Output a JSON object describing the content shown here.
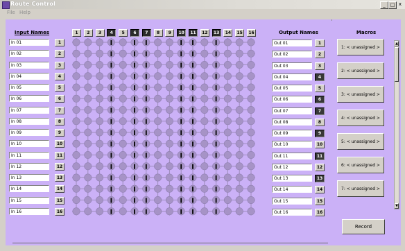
{
  "window": {
    "title": "Route Control",
    "minimize": "_",
    "restore": "□",
    "close": "x"
  },
  "menu": [
    "File",
    "Help"
  ],
  "headers": {
    "inputs": "Input Names",
    "outputs": "Output Names",
    "macros": "Macros"
  },
  "inputs": [
    "In 01",
    "In 02",
    "In 03",
    "In 04",
    "In 05",
    "In 06",
    "In 07",
    "In 08",
    "In 09",
    "In 10",
    "In 11",
    "In 12",
    "In 13",
    "In 14",
    "In 15",
    "In 16"
  ],
  "outputs": [
    "Out 01",
    "Out 02",
    "Out 03",
    "Out 04",
    "Out 05",
    "Out 06",
    "Out 07",
    "Out 08",
    "Out 09",
    "Out 10",
    "Out 11",
    "Out 12",
    "Out 13",
    "Out 14",
    "Out 15",
    "Out 16"
  ],
  "numbers": [
    "1",
    "2",
    "3",
    "4",
    "5",
    "6",
    "7",
    "8",
    "9",
    "10",
    "11",
    "12",
    "13",
    "14",
    "15",
    "16"
  ],
  "selected_columns": [
    4,
    6,
    7,
    10,
    11,
    13
  ],
  "selected_outputs": [
    4,
    6,
    7,
    9,
    11,
    13
  ],
  "macros": [
    "1: < unassigned >",
    "2: < unassigned >",
    "3: < unassigned >",
    "4: < unassigned >",
    "5: < unassigned >",
    "6: < unassigned >",
    "7: < unassigned >"
  ],
  "record_label": "Record",
  "colors": {
    "matrix_bg": "#cbb1f7",
    "node": "#a693c6",
    "route_line": "#000000"
  }
}
